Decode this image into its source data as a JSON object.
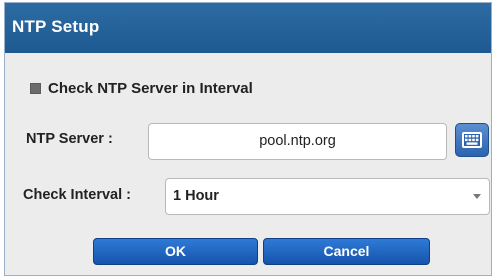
{
  "dialog": {
    "title": "NTP Setup",
    "check_server_label": "Check NTP Server in Interval",
    "check_server_checked": true,
    "ntp_server": {
      "label": "NTP Server :",
      "value": "pool.ntp.org",
      "keyboard_icon": "keyboard-icon"
    },
    "check_interval": {
      "label": "Check Interval :",
      "value": "1 Hour",
      "arrow_icon": "chevron-down-icon"
    },
    "buttons": {
      "ok": "OK",
      "cancel": "Cancel"
    }
  },
  "colors": {
    "titlebar": "#2466a0",
    "button": "#1f63be",
    "background": "#ececec"
  }
}
